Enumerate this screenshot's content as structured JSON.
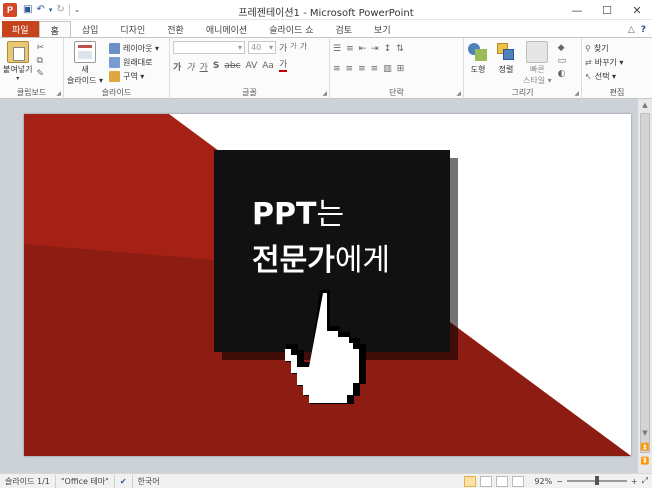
{
  "app": {
    "title": "프레젠테이션1 - Microsoft PowerPoint",
    "logo": "P"
  },
  "quick_access": [
    "save-icon",
    "undo-icon",
    "redo-icon",
    "customize-icon"
  ],
  "window_controls": {
    "minimize": "—",
    "maximize": "☐",
    "close": "✕"
  },
  "tabs": [
    {
      "label": "파일"
    },
    {
      "label": "홈"
    },
    {
      "label": "삽입"
    },
    {
      "label": "디자인"
    },
    {
      "label": "전환"
    },
    {
      "label": "애니메이션"
    },
    {
      "label": "슬라이드 쇼"
    },
    {
      "label": "검토"
    },
    {
      "label": "보기"
    }
  ],
  "tabs_right": {
    "collapse": "△",
    "help": "?"
  },
  "ribbon": {
    "clipboard": {
      "label": "클립보드",
      "paste": "붙여넣기"
    },
    "slides": {
      "label": "슬라이드",
      "new_slide_line1": "새",
      "new_slide_line2": "슬라이드 ▾",
      "layout": "레이아웃 ▾",
      "reset": "원래대로",
      "section": "구역 ▾"
    },
    "font": {
      "label": "글꼴",
      "font_name": "",
      "font_size": "40",
      "grow": "가",
      "shrink": "가",
      "clear": "가",
      "bold": "가",
      "italic": "가",
      "underline": "가",
      "strike": "S",
      "case": "Aa",
      "color": "가"
    },
    "paragraph": {
      "label": "단락"
    },
    "drawing": {
      "label": "그리기",
      "shapes": "도형",
      "arrange": "정렬",
      "quick_styles_line1": "빠른",
      "quick_styles_line2": "스타일 ▾"
    },
    "editing": {
      "label": "편집",
      "find": "찾기",
      "replace": "바꾸기 ▾",
      "select": "선택 ▾"
    }
  },
  "slide": {
    "line1_bold": "PPT",
    "line1_rest": "는",
    "line2_bold": "전문가",
    "line2_rest": "에게"
  },
  "status": {
    "slide_info": "슬라이드 1/1",
    "theme": "\"Office 테마\"",
    "language": "한국어",
    "zoom": "92%",
    "zoom_minus": "−",
    "zoom_plus": "+"
  },
  "colors": {
    "accent": "#c5441c",
    "slide_red": "#a52116",
    "slide_dark_red": "#7a1a12",
    "overlay": "#111111"
  }
}
